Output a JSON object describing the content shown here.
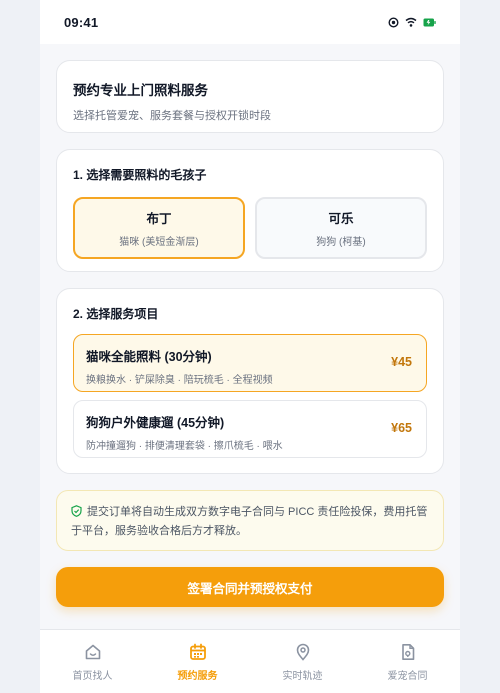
{
  "status_bar": {
    "time": "09:41"
  },
  "intro": {
    "title": "预约专业上门照料服务",
    "subtitle": "选择托管爱宠、服务套餐与授权开锁时段"
  },
  "pets_section": {
    "title": "1. 选择需要照料的毛孩子",
    "pets": [
      {
        "name": "布丁",
        "desc": "猫咪 (美短金渐层)",
        "selected": true
      },
      {
        "name": "可乐",
        "desc": "狗狗 (柯基)",
        "selected": false
      }
    ]
  },
  "services_section": {
    "title": "2. 选择服务项目",
    "services": [
      {
        "name": "猫咪全能照料 (30分钟)",
        "desc": "换粮换水 · 铲屎除臭 · 陪玩梳毛 · 全程视频",
        "price": "¥45",
        "selected": true
      },
      {
        "name": "狗狗户外健康遛 (45分钟)",
        "desc": "防冲撞遛狗 · 排便清理套袋 · 擦爪梳毛 · 喂水",
        "price": "¥65",
        "selected": false
      }
    ]
  },
  "notice": {
    "text": "提交订单将自动生成双方数字电子合同与 PICC 责任险投保，费用托管于平台，服务验收合格后方才释放。",
    "icon": "shield-check-icon"
  },
  "primary_button": {
    "label": "签署合同并预授权支付"
  },
  "tabbar": {
    "items": [
      {
        "label": "首页找人",
        "icon": "home-icon",
        "active": false
      },
      {
        "label": "预约服务",
        "icon": "calendar-icon",
        "active": true
      },
      {
        "label": "实时轨迹",
        "icon": "location-pin-icon",
        "active": false
      },
      {
        "label": "爱宠合同",
        "icon": "document-icon",
        "active": false
      }
    ]
  },
  "colors": {
    "accent": "#f59e0b",
    "selected_border": "#f5a623",
    "selected_bg": "#fef9e9",
    "price": "#c2770c",
    "notice_bg": "#fdfbee"
  }
}
